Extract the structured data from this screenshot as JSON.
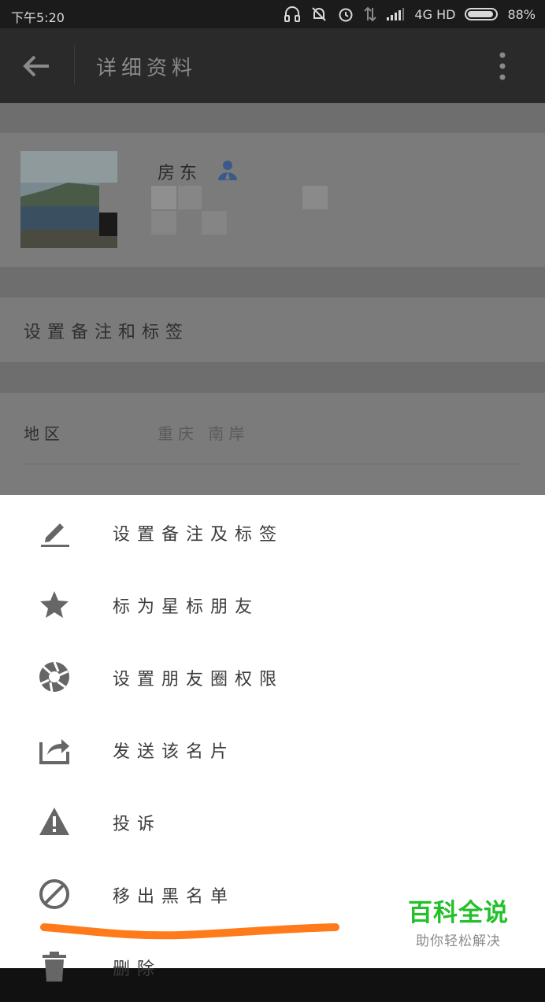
{
  "status_bar": {
    "time": "下午5:20",
    "network": "4G HD",
    "battery": "88%",
    "battery_level": 0.88,
    "icons": [
      "headphones-icon",
      "mute-bell-icon",
      "alarm-icon",
      "data-arrows-icon",
      "signal-icon",
      "battery-icon"
    ]
  },
  "toolbar": {
    "title": "详细资料",
    "back_icon": "arrow-left-icon",
    "more_icon": "more-vert-icon"
  },
  "profile": {
    "name": "房东",
    "badge_icon": "contact-person-icon"
  },
  "remark_row": {
    "label": "设置备注和标签"
  },
  "region_row": {
    "label": "地区",
    "value": "重庆  南岸"
  },
  "menu": {
    "items": [
      {
        "label": "设置备注及标签",
        "icon": "edit-pen-icon"
      },
      {
        "label": "标为星标朋友",
        "icon": "star-icon"
      },
      {
        "label": "设置朋友圈权限",
        "icon": "aperture-icon"
      },
      {
        "label": "发送该名片",
        "icon": "share-icon"
      },
      {
        "label": "投诉",
        "icon": "warning-icon"
      },
      {
        "label": "移出黑名单",
        "icon": "block-icon"
      },
      {
        "label": "删除",
        "icon": "trash-icon"
      }
    ]
  },
  "watermark": {
    "main": "百科全说",
    "sub": "助你轻松解决"
  },
  "colors": {
    "highlight_stroke": "#ff7a1a",
    "watermark_green": "#22c02a",
    "icon_gray": "#666666"
  }
}
